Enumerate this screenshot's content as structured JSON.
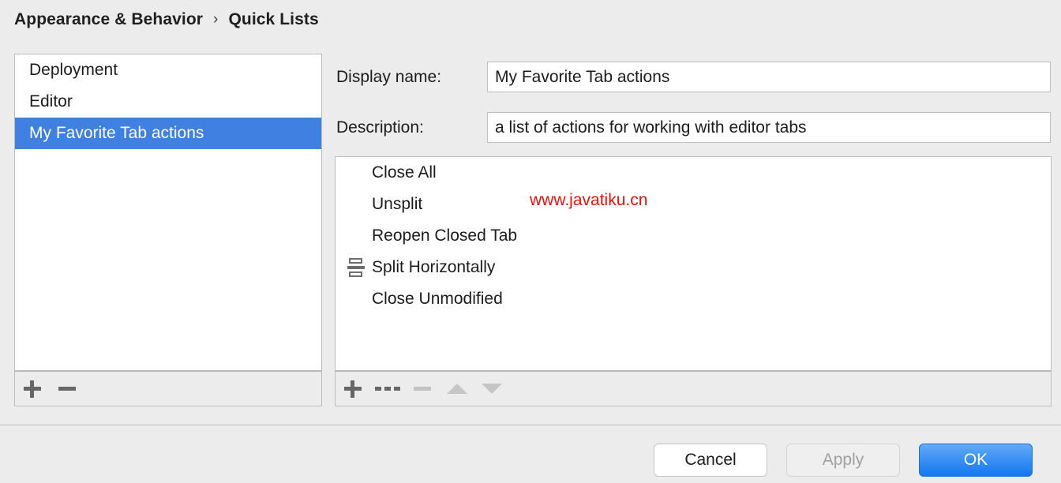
{
  "breadcrumb": {
    "parent": "Appearance & Behavior",
    "separator": "›",
    "current": "Quick Lists"
  },
  "quick_lists": {
    "items": [
      {
        "label": "Deployment",
        "selected": false
      },
      {
        "label": "Editor",
        "selected": false
      },
      {
        "label": "My Favorite Tab actions",
        "selected": true
      }
    ],
    "toolbar": {
      "add_label": "+",
      "remove_label": "−"
    }
  },
  "details": {
    "display_name_label": "Display name:",
    "display_name_value": "My Favorite Tab actions",
    "display_name_placeholder": "",
    "description_label": "Description:",
    "description_value": "a list of actions for working with editor tabs",
    "description_placeholder": ""
  },
  "actions": {
    "rows": [
      {
        "label": "Close All",
        "icon": ""
      },
      {
        "label": "Unsplit",
        "icon": ""
      },
      {
        "label": "Reopen Closed Tab",
        "icon": ""
      },
      {
        "label": "Split Horizontally",
        "icon": "split-horizontally-icon"
      },
      {
        "label": "Close Unmodified",
        "icon": ""
      }
    ],
    "toolbar": {
      "add_label": "+",
      "separator_label": "---",
      "remove_label": "−",
      "move_up_label": "▲",
      "move_down_label": "▼"
    }
  },
  "watermark": {
    "text": "www.javatiku.cn"
  },
  "footer": {
    "cancel_label": "Cancel",
    "apply_label": "Apply",
    "ok_label": "OK"
  },
  "colors": {
    "background": "#ececec",
    "selection_blue": "#4080e0",
    "ok_button_blue": "#1478ef",
    "watermark_red": "#e8120c",
    "border_gray": "#bdbdbd",
    "icon_gray": "#666666",
    "icon_disabled_gray": "#c6c6c6"
  }
}
